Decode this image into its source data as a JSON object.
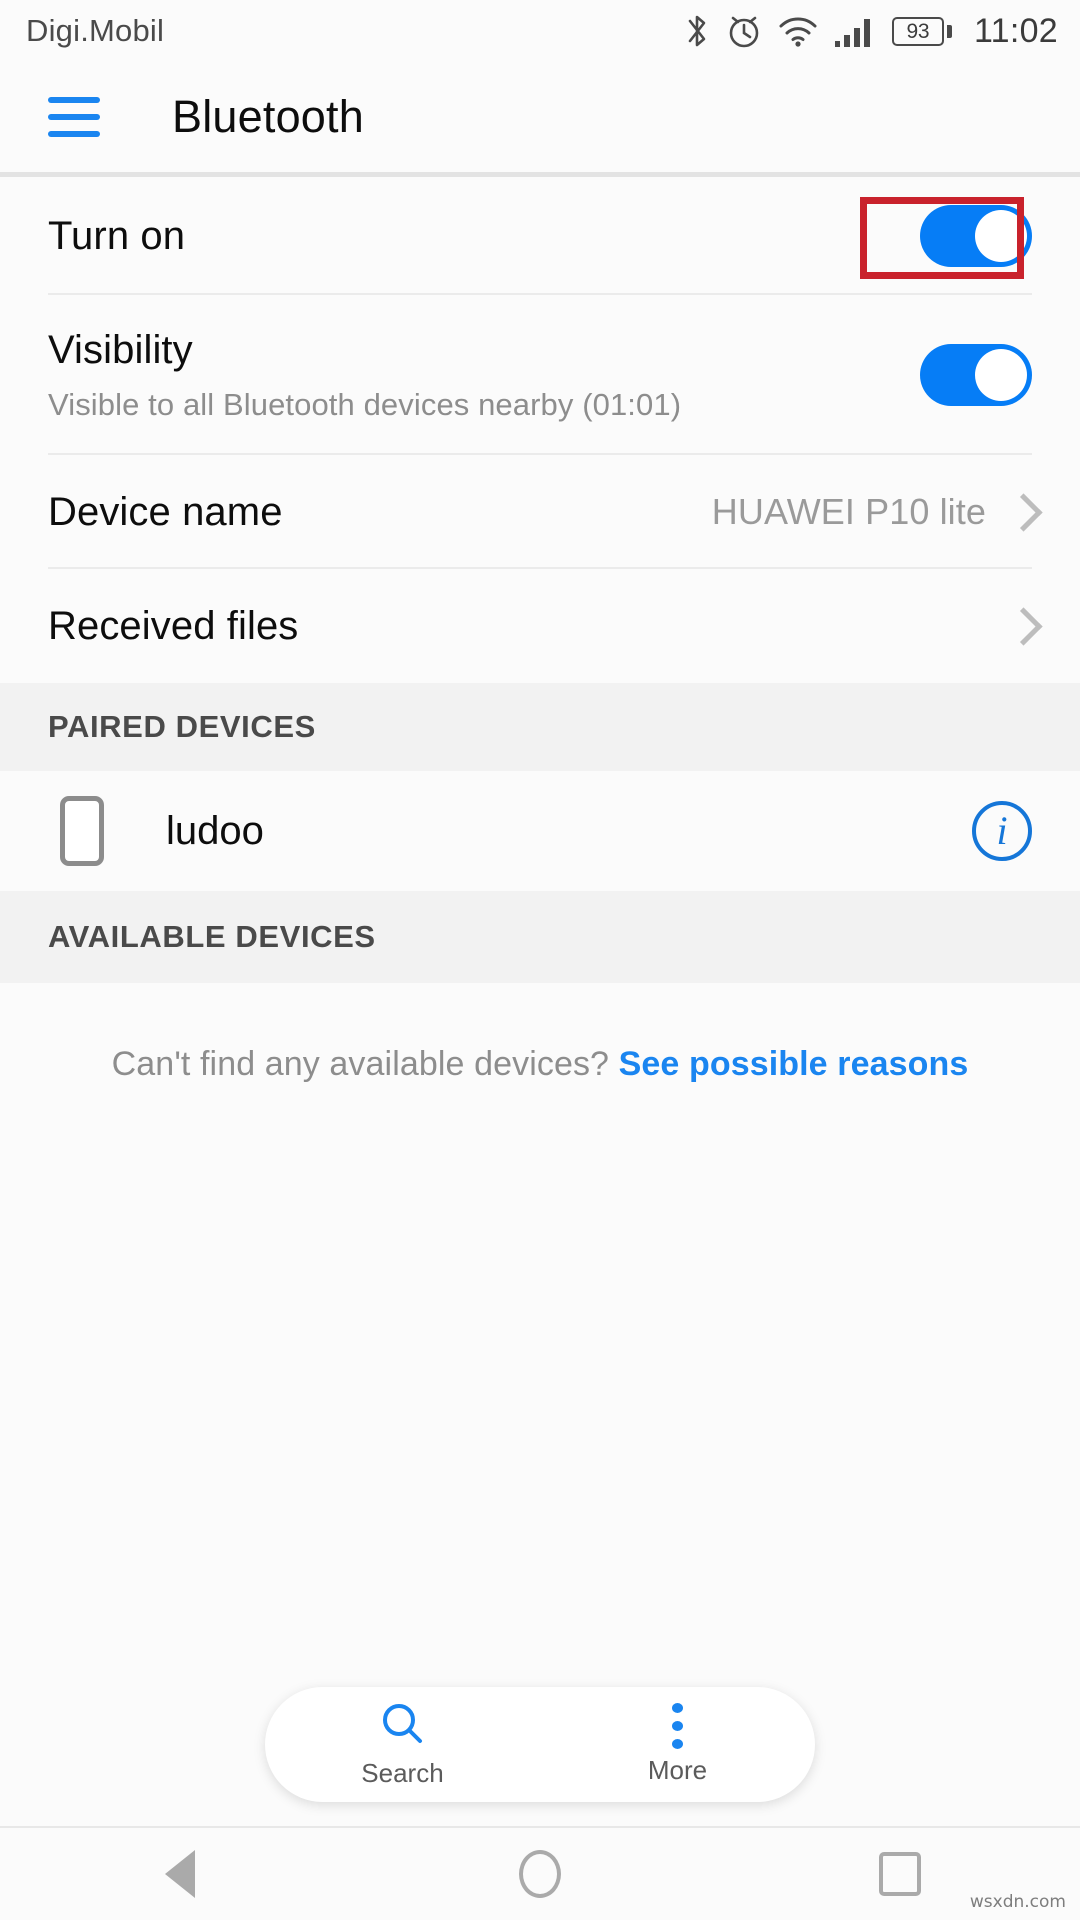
{
  "status_bar": {
    "carrier": "Digi.Mobil",
    "battery_percent": "93",
    "time": "11:02",
    "icons": [
      "bluetooth-icon",
      "alarm-icon",
      "wifi-icon",
      "signal-icon",
      "battery-icon"
    ]
  },
  "app_bar": {
    "menu_icon": "hamburger-menu-icon",
    "title": "Bluetooth"
  },
  "settings": {
    "turn_on": {
      "label": "Turn on",
      "toggle_state": "on",
      "highlighted": true
    },
    "visibility": {
      "label": "Visibility",
      "sublabel": "Visible to all Bluetooth devices nearby (01:01)",
      "toggle_state": "on"
    },
    "device_name": {
      "label": "Device name",
      "value": "HUAWEI P10 lite",
      "chevron": "chevron-right-icon"
    },
    "received_files": {
      "label": "Received files",
      "chevron": "chevron-right-icon"
    }
  },
  "paired_section": {
    "header": "PAIRED DEVICES",
    "devices": [
      {
        "name": "ludoo",
        "icon": "phone-device-icon",
        "info_icon": "info-circle-icon"
      }
    ]
  },
  "available_section": {
    "header": "AVAILABLE DEVICES",
    "empty_text": "Can't find any available devices?",
    "empty_link": "See possible reasons"
  },
  "bottom_bar": {
    "items": [
      {
        "label": "Search",
        "icon": "search-icon"
      },
      {
        "label": "More",
        "icon": "more-vertical-icon"
      }
    ]
  },
  "nav_bar": {
    "back": "back-triangle-icon",
    "home": "home-circle-icon",
    "recents": "recents-square-icon"
  },
  "watermark": "wsxdn.com",
  "colors": {
    "accent_blue": "#067df6",
    "link_blue": "#1a85f0",
    "highlight_red": "#c9222c",
    "section_bg": "#f2f2f2",
    "page_bg": "#fbfbfb"
  }
}
